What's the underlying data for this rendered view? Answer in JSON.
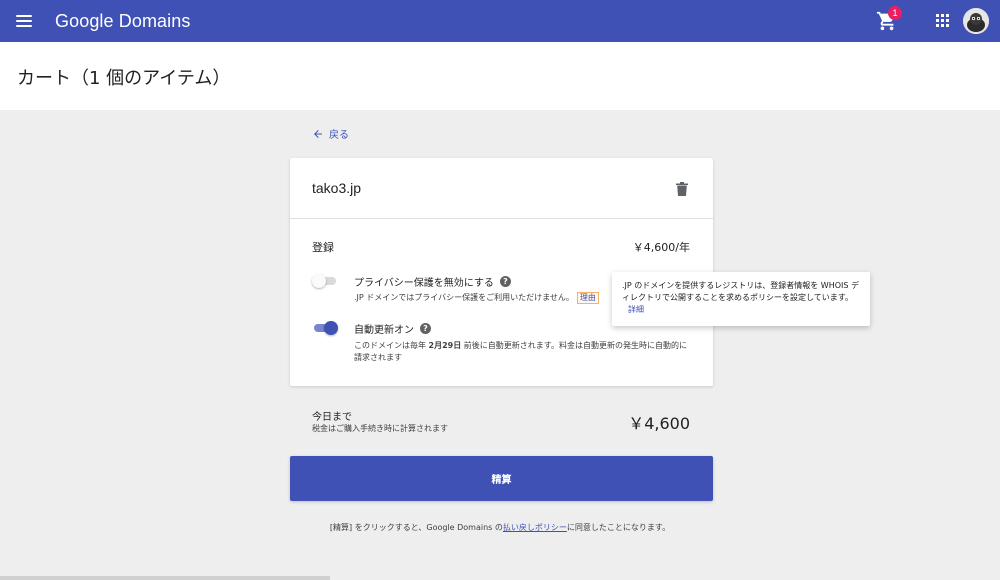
{
  "header": {
    "brand": "Google Domains",
    "cart_count": "1",
    "icons": {
      "menu": "menu-icon",
      "cart": "cart-icon",
      "apps": "apps-grid-icon",
      "avatar": "avatar"
    },
    "color": "#3f51b5"
  },
  "page": {
    "title": "カート（1 個のアイテム）"
  },
  "back": {
    "label": "戻る"
  },
  "cart_item": {
    "domain": "tako3.jp",
    "registration_label": "登録",
    "registration_price": "￥4,600/年",
    "privacy": {
      "title": "プライバシー保護を無効にする",
      "description": ".JP ドメインではプライバシー保護をご利用いただけません。",
      "reason_link": "理由",
      "enabled": false
    },
    "autorenew": {
      "title": "自動更新オン",
      "description_pre": "このドメインは毎年 ",
      "description_date": "2月29日",
      "description_post": " 前後に自動更新されます。料金は自動更新の発生時に自動的に請求されます",
      "enabled": true
    }
  },
  "tooltip": {
    "text": ".JP のドメインを提供するレジストリは、登録者情報を WHOIS ディレクトリで公開することを求めるポリシーを設定しています。",
    "link": "詳細"
  },
  "totals": {
    "label": "今日まで",
    "note": "税金はご購入手続き時に計算されます",
    "amount": "￥4,600"
  },
  "checkout": {
    "label": "精算"
  },
  "footer": {
    "pre": "[精算] をクリックすると、Google Domains の",
    "link": "払い戻しポリシー",
    "post": "に同意したことになります。"
  }
}
